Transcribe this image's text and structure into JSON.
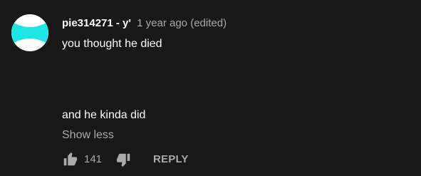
{
  "comment": {
    "avatar_icon": "user-avatar",
    "author": "pie314271 - y'",
    "timestamp": "1 year ago",
    "edited_label": "(edited)",
    "text_line_1": "you thought he died",
    "text_line_2": "and he kinda did",
    "show_less_label": "Show less",
    "like_icon": "thumbs-up-icon",
    "like_count": "141",
    "dislike_icon": "thumbs-down-icon",
    "reply_label": "REPLY"
  },
  "colors": {
    "background": "#181818",
    "primary_text": "#ffffff",
    "secondary_text": "#aaaaaa",
    "avatar_cyan": "#1de6e6",
    "avatar_white": "#ffffff"
  }
}
